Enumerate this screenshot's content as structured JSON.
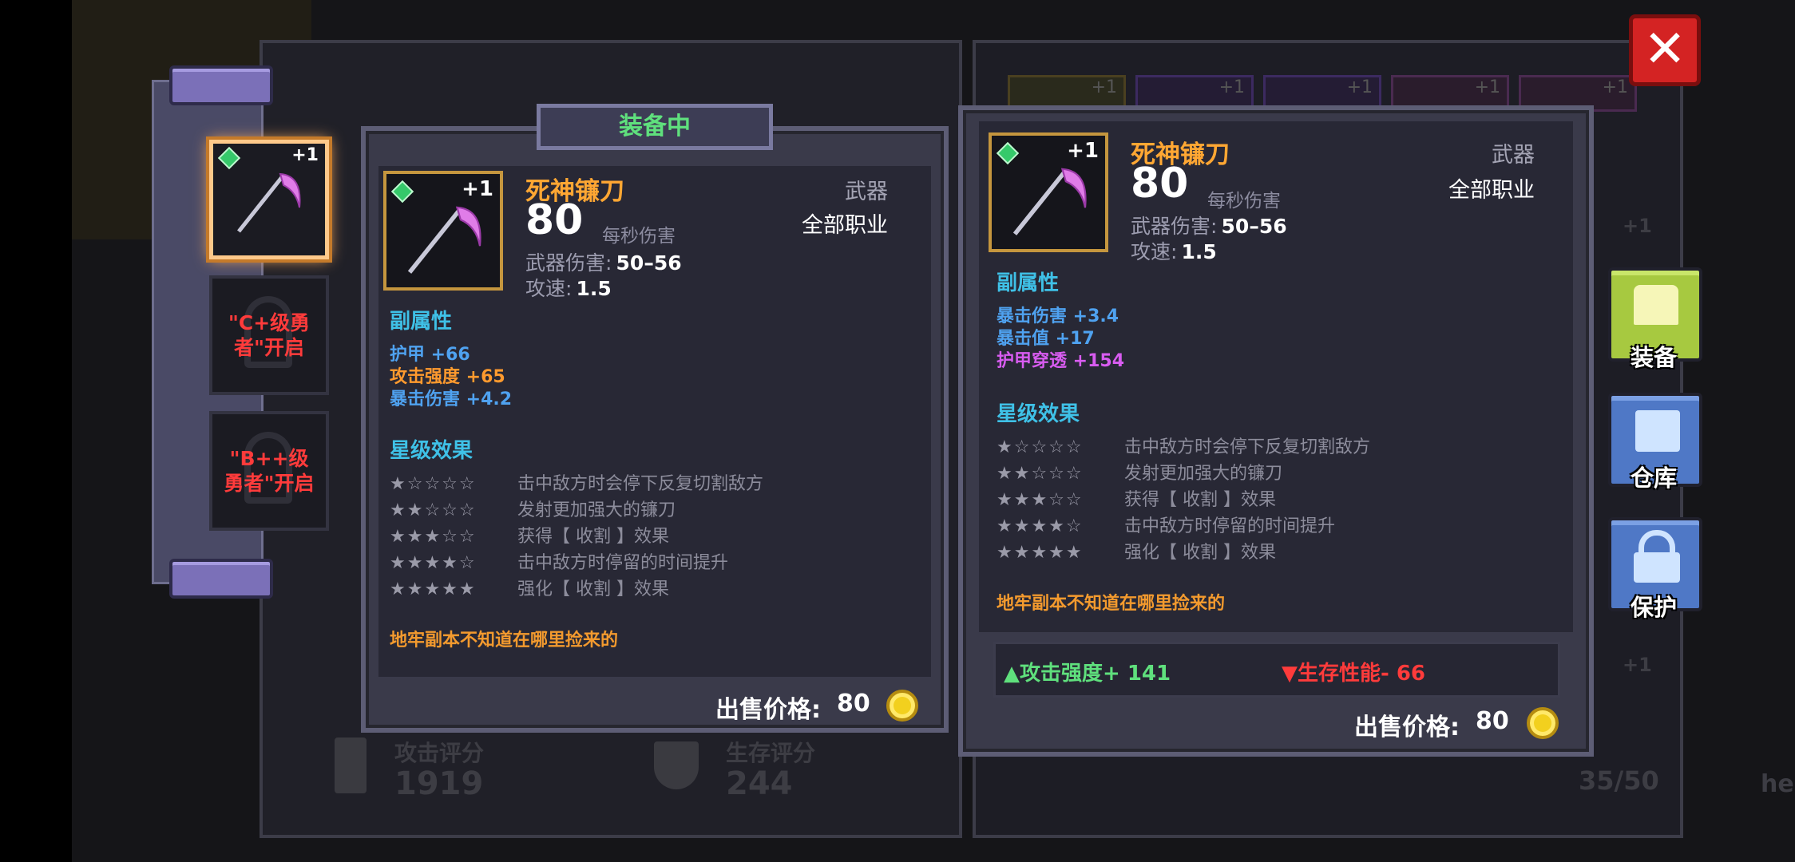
{
  "background": {
    "attack_score_label": "攻击评分",
    "attack_score_value": "1919",
    "survival_score_label": "生存评分",
    "survival_score_value": "244",
    "inventory_count": "35/50",
    "top_plus_labels": [
      "+1",
      "+1",
      "+1",
      "+1",
      "+1"
    ],
    "side_plus_labels": [
      "+1",
      "+1"
    ],
    "clipped_text": "he"
  },
  "slots": [
    {
      "state": "equipped",
      "plus": "+1"
    },
    {
      "state": "locked",
      "text": "\"C+级勇者\"开启"
    },
    {
      "state": "locked",
      "text": "\"B++级勇者\"开启"
    }
  ],
  "equipped_card": {
    "header": "装备中",
    "plus": "+1",
    "name": "死神镰刀",
    "dps": "80",
    "dps_label": "每秒伤害",
    "type": "武器",
    "class": "全部职业",
    "weapon_damage_label": "武器伤害:",
    "weapon_damage_value": "50–56",
    "attack_speed_label": "攻速:",
    "attack_speed_value": "1.5",
    "substats_title": "副属性",
    "substats": [
      {
        "label": "护甲 +66",
        "color": "#4fa2f0"
      },
      {
        "label": "攻击强度 +65",
        "color": "#ff9a2e"
      },
      {
        "label": "暴击伤害 +4.2",
        "color": "#4fa2f0"
      }
    ],
    "star_title": "星级效果",
    "star_effects": [
      {
        "stars": 1,
        "text": "击中敌方时会停下反复切割敌方"
      },
      {
        "stars": 2,
        "text": "发射更加强大的镰刀"
      },
      {
        "stars": 3,
        "text": "获得【 收割 】效果"
      },
      {
        "stars": 4,
        "text": "击中敌方时停留的时间提升"
      },
      {
        "stars": 5,
        "text": "强化【 收割 】效果"
      }
    ],
    "flavor": "地牢副本不知道在哪里捡来的",
    "sell_label": "出售价格:",
    "sell_value": "80"
  },
  "compare_card": {
    "plus": "+1",
    "name": "死神镰刀",
    "dps": "80",
    "dps_label": "每秒伤害",
    "type": "武器",
    "class": "全部职业",
    "weapon_damage_label": "武器伤害:",
    "weapon_damage_value": "50–56",
    "attack_speed_label": "攻速:",
    "attack_speed_value": "1.5",
    "substats_title": "副属性",
    "substats": [
      {
        "label": "暴击伤害 +3.4",
        "color": "#4fa2f0"
      },
      {
        "label": "暴击值 +17",
        "color": "#4fa2f0"
      },
      {
        "label": "护甲穿透 +154",
        "color": "#d85cf0"
      }
    ],
    "star_title": "星级效果",
    "star_effects": [
      {
        "stars": 1,
        "text": "击中敌方时会停下反复切割敌方"
      },
      {
        "stars": 2,
        "text": "发射更加强大的镰刀"
      },
      {
        "stars": 3,
        "text": "获得【 收割 】效果"
      },
      {
        "stars": 4,
        "text": "击中敌方时停留的时间提升"
      },
      {
        "stars": 5,
        "text": "强化【 收割 】效果"
      }
    ],
    "flavor": "地牢副本不知道在哪里捡来的",
    "compare_up": "▲攻击强度+ 141",
    "compare_down": "▼生存性能- 66",
    "sell_label": "出售价格:",
    "sell_value": "80"
  },
  "side_buttons": {
    "equip": "装备",
    "warehouse": "仓库",
    "protect": "保护"
  },
  "close_icon": "✕",
  "colors": {
    "orange_name": "#ffa733",
    "section_cyan": "#3fc1e7",
    "up_green": "#5fe07d",
    "down_red": "#ff3b3b"
  }
}
